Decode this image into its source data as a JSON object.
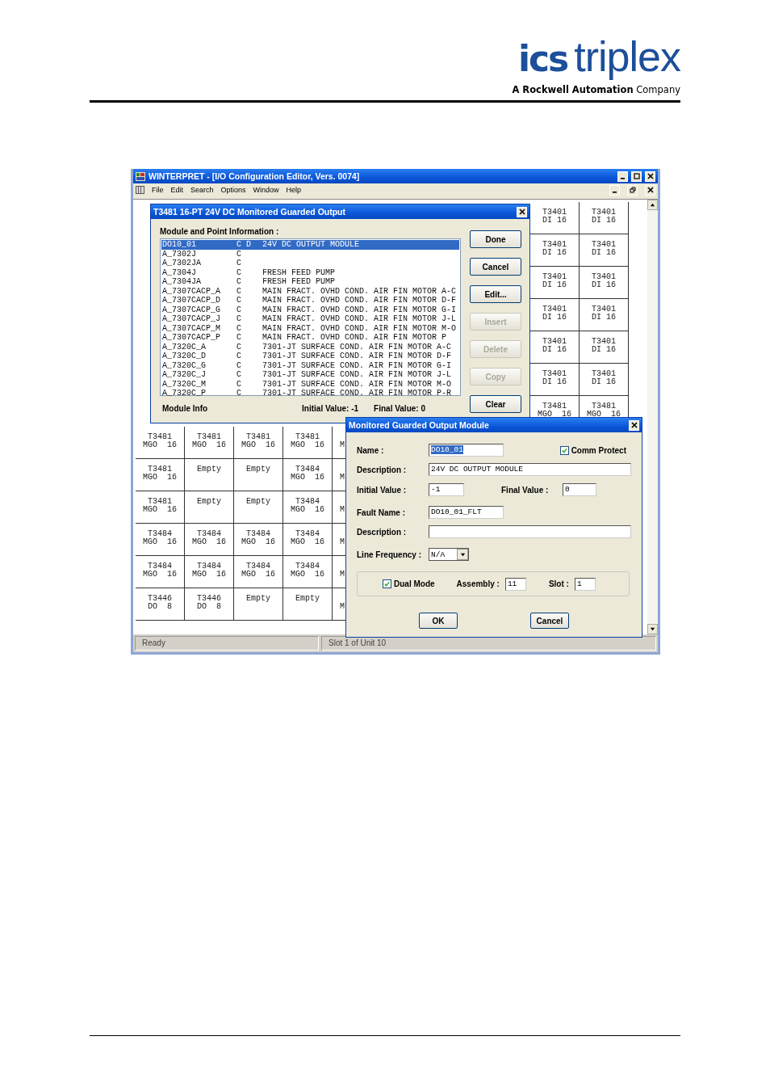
{
  "logo": {
    "brand": [
      "ics",
      "triplex"
    ],
    "tagline": "**A Rockwell Automation** Company"
  },
  "window": {
    "title": "WINTERPRET - [I/O Configuration Editor, Vers. 0074]",
    "menu": [
      "File",
      "Edit",
      "Search",
      "Options",
      "Window",
      "Help"
    ],
    "right_grid": [
      [
        {
          "top": "T3401",
          "bottom": "DI 16"
        },
        {
          "top": "T3401",
          "bottom": "DI 16"
        }
      ],
      [
        {
          "top": "T3401",
          "bottom": "DI 16"
        },
        {
          "top": "T3401",
          "bottom": "DI 16"
        }
      ],
      [
        {
          "top": "T3401",
          "bottom": "DI 16"
        },
        {
          "top": "T3401",
          "bottom": "DI 16"
        }
      ],
      [
        {
          "top": "T3401",
          "bottom": "DI 16"
        },
        {
          "top": "T3401",
          "bottom": "DI 16"
        }
      ],
      [
        {
          "top": "T3401",
          "bottom": "DI 16"
        },
        {
          "top": "T3401",
          "bottom": "DI 16"
        }
      ],
      [
        {
          "top": "T3401",
          "bottom": "DI 16"
        },
        {
          "top": "T3401",
          "bottom": "DI 16"
        }
      ],
      [
        {
          "top": "T3481",
          "bottom": "MGO  16"
        },
        {
          "top": "T3481",
          "bottom": "MGO  16"
        }
      ]
    ],
    "bottom_grid": [
      [
        {
          "top": "T3481",
          "bottom": "MGO  16"
        },
        {
          "top": "T3481",
          "bottom": "MGO  16"
        },
        {
          "top": "T3481",
          "bottom": "MGO  16"
        },
        {
          "top": "T3481",
          "bottom": "MGO  16"
        },
        {
          "bottom": "M"
        }
      ],
      [
        {
          "top": "T3481",
          "bottom": "MGO  16"
        },
        {
          "top": "Empty"
        },
        {
          "top": "Empty"
        },
        {
          "top": "T3484",
          "bottom": "MGO  16"
        },
        {
          "bottom": "M"
        }
      ],
      [
        {
          "top": "T3481",
          "bottom": "MGO  16"
        },
        {
          "top": "Empty"
        },
        {
          "top": "Empty"
        },
        {
          "top": "T3484",
          "bottom": "MGO  16"
        },
        {
          "bottom": "M"
        }
      ],
      [
        {
          "top": "T3484",
          "bottom": "MGO  16"
        },
        {
          "top": "T3484",
          "bottom": "MGO  16"
        },
        {
          "top": "T3484",
          "bottom": "MGO  16"
        },
        {
          "top": "T3484",
          "bottom": "MGO  16"
        },
        {
          "bottom": "M"
        }
      ],
      [
        {
          "top": "T3484",
          "bottom": "MGO  16"
        },
        {
          "top": "T3484",
          "bottom": "MGO  16"
        },
        {
          "top": "T3484",
          "bottom": "MGO  16"
        },
        {
          "top": "T3484",
          "bottom": "MGO  16"
        },
        {
          "bottom": "M"
        }
      ],
      [
        {
          "top": "T3446",
          "bottom": "DO  8"
        },
        {
          "top": "T3446",
          "bottom": "DO  8"
        },
        {
          "top": "Empty"
        },
        {
          "top": "Empty"
        },
        {
          "bottom": "M"
        }
      ]
    ],
    "status_bar": [
      "Ready",
      "Slot 1 of Unit 10"
    ]
  },
  "module_dialog": {
    "title": "T3481 16-PT  24V DC Monitored Guarded Output",
    "section_label": "Module and Point Information :",
    "points": [
      {
        "name": "DO10_01",
        "flags": "C D",
        "description": "24V DC OUTPUT MODULE",
        "selected": true
      },
      {
        "name": "A_7302J",
        "flags": "C",
        "selected": false
      },
      {
        "name": "A_7302JA",
        "flags": "C",
        "selected": false
      },
      {
        "name": "A_7304J",
        "flags": "C",
        "description": "FRESH FEED PUMP",
        "selected": false
      },
      {
        "name": "A_7304JA",
        "flags": "C",
        "description": "FRESH FEED PUMP",
        "selected": false
      },
      {
        "name": "A_7307CACP_A",
        "flags": "C",
        "description": "MAIN FRACT. OVHD COND. AIR FIN MOTOR A-C",
        "selected": false
      },
      {
        "name": "A_7307CACP_D",
        "flags": "C",
        "description": "MAIN FRACT. OVHD COND. AIR FIN MOTOR D-F",
        "selected": false
      },
      {
        "name": "A_7307CACP_G",
        "flags": "C",
        "description": "MAIN FRACT. OVHD COND. AIR FIN MOTOR G-I",
        "selected": false
      },
      {
        "name": "A_7307CACP_J",
        "flags": "C",
        "description": "MAIN FRACT. OVHD COND. AIR FIN MOTOR J-L",
        "selected": false
      },
      {
        "name": "A_7307CACP_M",
        "flags": "C",
        "description": "MAIN FRACT. OVHD COND. AIR FIN MOTOR M-O",
        "selected": false
      },
      {
        "name": "A_7307CACP_P",
        "flags": "C",
        "description": "MAIN FRACT. OVHD COND. AIR FIN MOTOR P",
        "selected": false
      },
      {
        "name": "A_7320C_A",
        "flags": "C",
        "description": "7301-JT SURFACE COND. AIR FIN MOTOR A-C",
        "selected": false
      },
      {
        "name": "A_7320C_D",
        "flags": "C",
        "description": "7301-JT SURFACE COND. AIR FIN MOTOR D-F",
        "selected": false
      },
      {
        "name": "A_7320C_G",
        "flags": "C",
        "description": "7301-JT SURFACE COND. AIR FIN MOTOR G-I",
        "selected": false
      },
      {
        "name": "A_7320C_J",
        "flags": "C",
        "description": "7301-JT SURFACE COND. AIR FIN MOTOR J-L",
        "selected": false
      },
      {
        "name": "A_7320C_M",
        "flags": "C",
        "description": "7301-JT SURFACE COND. AIR FIN MOTOR M-O",
        "selected": false
      },
      {
        "name": "A_7320C_P",
        "flags": "C",
        "description": "7301-JT SURFACE COND. AIR FIN MOTOR P-R",
        "selected": false
      }
    ],
    "buttons": [
      {
        "label": "Done",
        "disabled": false
      },
      {
        "label": "Cancel",
        "disabled": false
      },
      {
        "label": "Edit...",
        "disabled": false
      },
      {
        "label": "Insert",
        "disabled": true
      },
      {
        "label": "Delete",
        "disabled": true
      },
      {
        "label": "Copy",
        "disabled": true
      },
      {
        "label": "Clear",
        "disabled": false
      }
    ],
    "footer": {
      "label": "Module Info",
      "initial_value": "Initial Value: -1",
      "final_value": "Final Value: 0"
    }
  },
  "edit_dialog": {
    "title": "Monitored Guarded Output Module",
    "name": {
      "label": "Name :",
      "value": "DO10_01",
      "selected": true
    },
    "comm_protect": {
      "label": "Comm Protect",
      "checked": true
    },
    "description": {
      "label": "Description :",
      "value": "24V DC OUTPUT MODULE"
    },
    "initial_value": {
      "label": "Initial Value :",
      "value": "-1"
    },
    "final_value": {
      "label": "Final Value :",
      "value": "0"
    },
    "fault_name": {
      "label": "Fault Name :",
      "value": "DO10_01_FLT"
    },
    "fault_description": {
      "label": "Description :"
    },
    "line_frequency": {
      "label": "Line Frequency :",
      "value": "N/A"
    },
    "dual_mode": {
      "label": "Dual Mode",
      "checked": true
    },
    "assembly": {
      "label": "Assembly :",
      "value": "11"
    },
    "slot": {
      "label": "Slot :",
      "value": "1"
    },
    "buttons": [
      "OK",
      "Cancel"
    ]
  }
}
